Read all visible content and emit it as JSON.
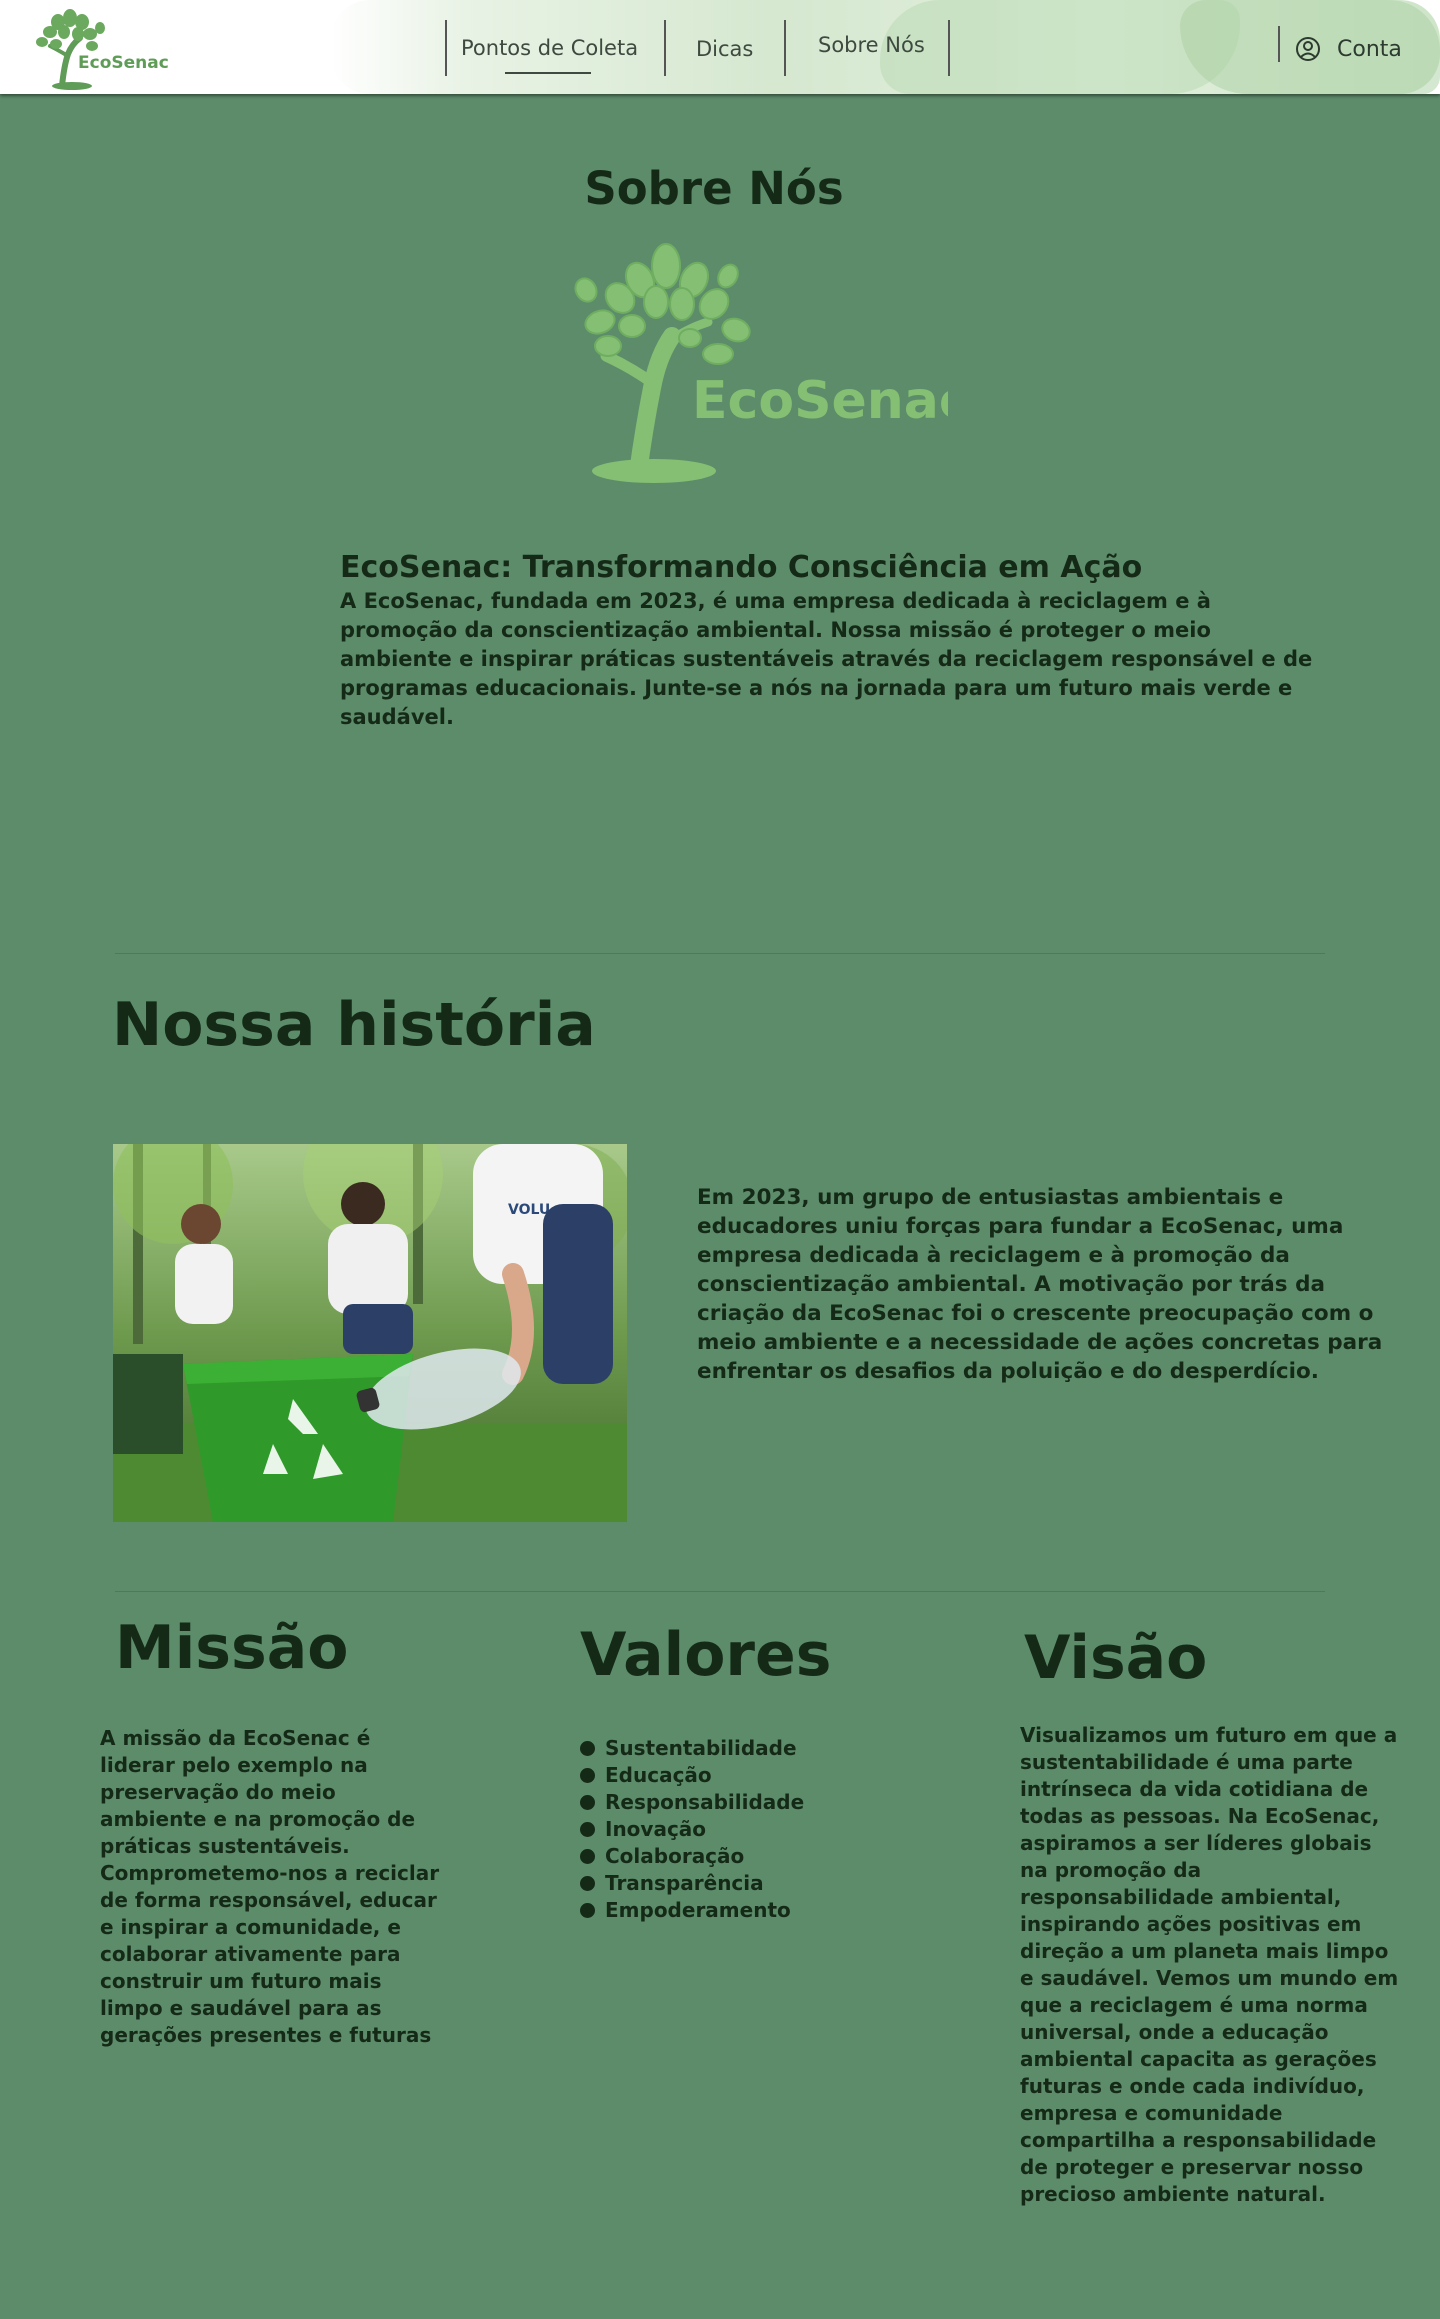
{
  "header": {
    "logo_text": "EcoSenac",
    "nav": [
      {
        "label": "Pontos de Coleta"
      },
      {
        "label": "Dicas"
      },
      {
        "label": "Sobre Nós"
      }
    ],
    "account_label": "Conta"
  },
  "about": {
    "title": "Sobre Nós",
    "logo_text": "EcoSenac",
    "heading": "EcoSenac: Transformando Consciência em Ação",
    "body": "  A EcoSenac, fundada em 2023, é uma empresa dedicada à reciclagem e à promoção da conscientização ambiental. Nossa missão é proteger o meio ambiente e inspirar práticas sustentáveis através da reciclagem responsável e de programas educacionais. Junte-se a nós na jornada para um futuro mais verde e saudável."
  },
  "history": {
    "title": "Nossa história",
    "text": "Em 2023, um grupo de entusiastas ambientais e educadores uniu forças para fundar a EcoSenac, uma empresa dedicada à reciclagem e à promoção da conscientização ambiental. A motivação por trás da criação da EcoSenac foi o crescente preocupação com o meio ambiente e a necessidade de ações concretas para enfrentar os desafios da poluição e do desperdício.",
    "photo_vest_text": "VOLU"
  },
  "mission": {
    "title": "Missão",
    "text": " A missão da EcoSenac é liderar pelo exemplo na preservação do meio ambiente e na promoção de práticas sustentáveis. Comprometemo-nos a reciclar de forma responsável, educar e inspirar a comunidade, e colaborar ativamente para construir um futuro mais limpo e saudável para as gerações presentes e futuras"
  },
  "values": {
    "title": "Valores",
    "items": [
      "Sustentabilidade",
      "Educação",
      "Responsabilidade",
      "Inovação",
      "Colaboração",
      "Transparência",
      "Empoderamento"
    ]
  },
  "vision": {
    "title": "Visão",
    "text": " Visualizamos um futuro em que a sustentabilidade é uma parte intrínseca da vida cotidiana de todas as pessoas. Na EcoSenac, aspiramos a ser líderes globais na promoção da responsabilidade ambiental, inspirando ações positivas em direção a um planeta mais limpo e saudável. Vemos um mundo em que a reciclagem é uma norma universal, onde a educação ambiental capacita as gerações futuras e onde cada indivíduo, empresa e comunidade compartilha a responsabilidade de proteger e preservar nosso precioso ambiente natural."
  },
  "colors": {
    "page_bg": "#5d8c6a",
    "text_dark": "#142a17",
    "logo_light_green": "#85bf73",
    "logo_dark_green": "#4e9a52",
    "recycling_bin_green": "#2f9a2a"
  }
}
